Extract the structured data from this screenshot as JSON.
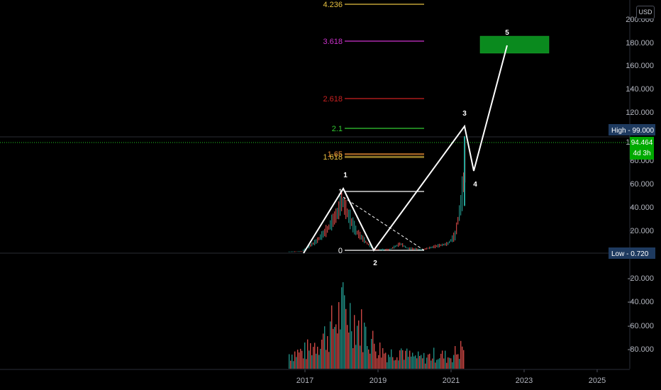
{
  "chart_data": {
    "type": "candlestick",
    "currency": "USD",
    "y_axis_labels": [
      "200.000",
      "180.000",
      "160.000",
      "140.000",
      "120.000",
      "100.000",
      "80.000",
      "60.000",
      "40.000",
      "20.000",
      "-20.000",
      "-40.000",
      "-60.000",
      "-80.000"
    ],
    "x_axis_labels": [
      "2017",
      "2019",
      "2021",
      "2023",
      "2025"
    ],
    "price_tags": [
      {
        "label": "High - 99.000",
        "price": 99.0
      },
      {
        "label": "Low - 0.720",
        "price": 0.72
      }
    ],
    "current_price": {
      "value": "94.464",
      "countdown": "4d 3h",
      "price": 94.464
    },
    "fib_levels": [
      {
        "label": "4.236",
        "price": 208,
        "color": "#e6c040"
      },
      {
        "label": "3.618",
        "price": 180,
        "color": "#cc33cc"
      },
      {
        "label": "2.618",
        "price": 132,
        "color": "#cc2222"
      },
      {
        "label": "2.1",
        "price": 107,
        "color": "#33cc33"
      },
      {
        "label": "1.65",
        "price": 85,
        "color": "#e68a33"
      },
      {
        "label": "1.618",
        "price": 83,
        "color": "#e6c040"
      },
      {
        "label": "1",
        "price": 53,
        "color": "#ffffff"
      },
      {
        "label": "0",
        "price": 3,
        "color": "#ffffff"
      }
    ],
    "wave_labels": [
      {
        "label": "1",
        "date": 2018.0
      },
      {
        "label": "2",
        "date": 2018.9
      },
      {
        "label": "3",
        "date": 2021.4
      },
      {
        "label": "4",
        "date": 2021.7
      },
      {
        "label": "5",
        "date": 2022.5
      }
    ],
    "wave_path": [
      {
        "date": 2016.9,
        "price": 0.72
      },
      {
        "date": 2018.0,
        "price": 55
      },
      {
        "date": 2018.9,
        "price": 3
      },
      {
        "date": 2021.4,
        "price": 108
      },
      {
        "date": 2021.7,
        "price": 70
      },
      {
        "date": 2022.5,
        "price": 177
      }
    ],
    "target_zone": {
      "date_start": 2021.85,
      "date_end": 2023.7,
      "price_low": 169,
      "price_high": 183
    },
    "price_series": [
      {
        "date": 2016.4,
        "price": 1
      },
      {
        "date": 2016.9,
        "price": 1.5
      },
      {
        "date": 2017.3,
        "price": 10
      },
      {
        "date": 2017.6,
        "price": 20
      },
      {
        "date": 2017.9,
        "price": 35
      },
      {
        "date": 2018.0,
        "price": 45
      },
      {
        "date": 2018.2,
        "price": 30
      },
      {
        "date": 2018.4,
        "price": 18
      },
      {
        "date": 2018.7,
        "price": 8
      },
      {
        "date": 2018.9,
        "price": 3
      },
      {
        "date": 2019.3,
        "price": 3
      },
      {
        "date": 2019.6,
        "price": 8
      },
      {
        "date": 2019.8,
        "price": 4
      },
      {
        "date": 2020.2,
        "price": 3
      },
      {
        "date": 2020.6,
        "price": 6
      },
      {
        "date": 2020.9,
        "price": 8
      },
      {
        "date": 2021.1,
        "price": 15
      },
      {
        "date": 2021.25,
        "price": 40
      },
      {
        "date": 2021.35,
        "price": 65
      },
      {
        "date": 2021.4,
        "price": 99
      },
      {
        "date": 2021.42,
        "price": 94.464
      }
    ],
    "volume": [
      {
        "date": 2016.5,
        "value": 25
      },
      {
        "date": 2017.0,
        "value": 30
      },
      {
        "date": 2017.3,
        "value": 45
      },
      {
        "date": 2017.6,
        "value": 60
      },
      {
        "date": 2017.9,
        "value": 88
      },
      {
        "date": 2018.0,
        "value": 100
      },
      {
        "date": 2018.2,
        "value": 95
      },
      {
        "date": 2018.4,
        "value": 80
      },
      {
        "date": 2018.6,
        "value": 65
      },
      {
        "date": 2018.8,
        "value": 50
      },
      {
        "date": 2019.0,
        "value": 35
      },
      {
        "date": 2019.3,
        "value": 25
      },
      {
        "date": 2019.6,
        "value": 35
      },
      {
        "date": 2019.8,
        "value": 22
      },
      {
        "date": 2020.2,
        "value": 18
      },
      {
        "date": 2020.6,
        "value": 25
      },
      {
        "date": 2020.9,
        "value": 20
      },
      {
        "date": 2021.2,
        "value": 30
      },
      {
        "date": 2021.4,
        "value": 45
      }
    ]
  }
}
